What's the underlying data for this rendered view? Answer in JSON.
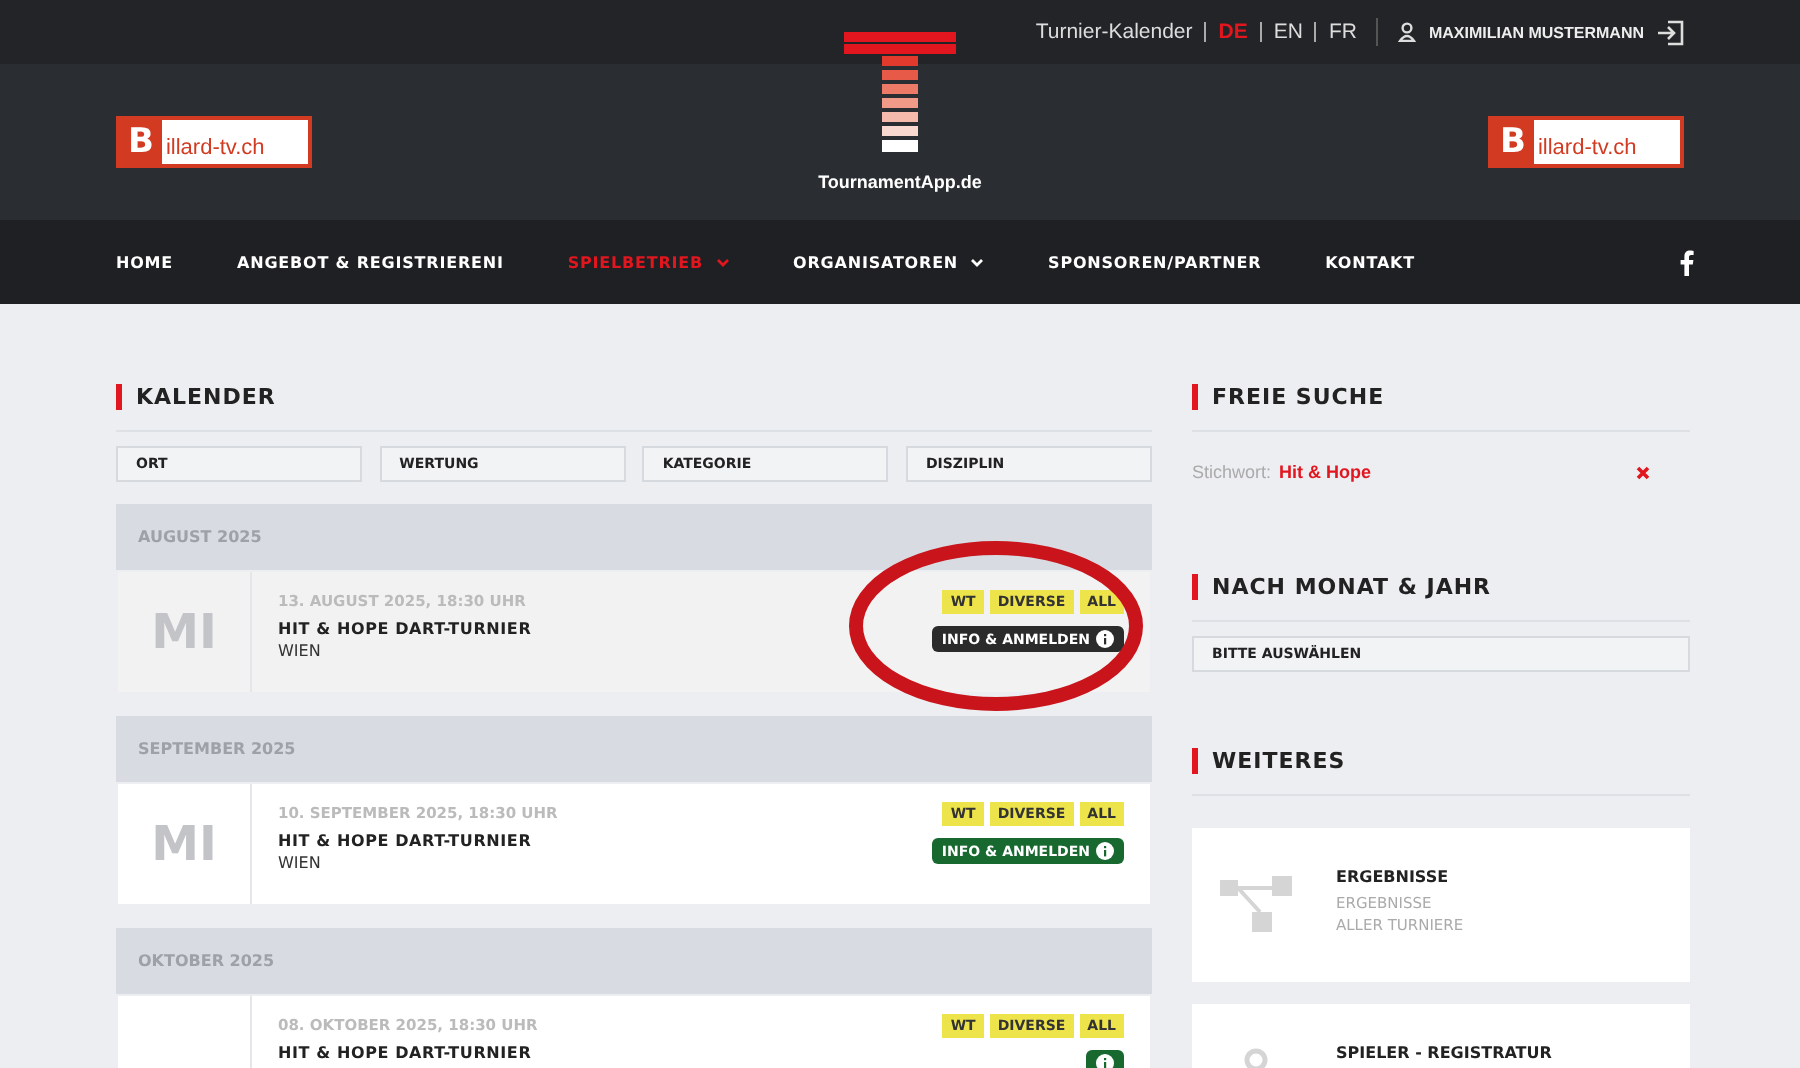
{
  "topbar": {
    "link": "Turnier-Kalender",
    "languages": [
      {
        "label": "DE",
        "selected": true
      },
      {
        "label": "EN",
        "selected": false
      },
      {
        "label": "FR",
        "selected": false
      }
    ],
    "user": "MAXIMILIAN MUSTERMANN"
  },
  "header": {
    "logo_letter": "B",
    "logo_left": "illard-tv.ch",
    "logo_right_letter": "B",
    "logo_center": "TournamentApp.de",
    "logo_right": "illard-tv.ch"
  },
  "nav": [
    {
      "label": "HOME",
      "selected": false,
      "dropdown": false
    },
    {
      "label": "ANGEBOT & REGISTRIERENI",
      "selected": false,
      "dropdown": false
    },
    {
      "label": "SPIELBETRIEB",
      "selected": true,
      "dropdown": true
    },
    {
      "label": "ORGANISATOREN",
      "selected": false,
      "dropdown": true
    },
    {
      "label": "SPONSOREN/PARTNER",
      "selected": false,
      "dropdown": false
    },
    {
      "label": "KONTAKT",
      "selected": false,
      "dropdown": false
    }
  ],
  "calendar": {
    "title": "KALENDER",
    "filters": [
      "ORT",
      "WERTUNG",
      "KATEGORIE",
      "DISZIPLIN"
    ],
    "months": [
      {
        "label": "AUGUST 2025",
        "events": [
          {
            "day": "MI",
            "date": "13. AUGUST 2025, 18:30 UHR",
            "title": "HIT & HOPE DART-TURNIER",
            "place": "WIEN",
            "tags": [
              "WT",
              "DIVERSE",
              "ALL"
            ],
            "button": "INFO & ANMELDEN",
            "past": true
          }
        ]
      },
      {
        "label": "SEPTEMBER 2025",
        "events": [
          {
            "day": "MI",
            "date": "10. SEPTEMBER 2025, 18:30 UHR",
            "title": "HIT & HOPE DART-TURNIER",
            "place": "WIEN",
            "tags": [
              "WT",
              "DIVERSE",
              "ALL"
            ],
            "button": "INFO & ANMELDEN",
            "past": false
          }
        ]
      },
      {
        "label": "OKTOBER 2025",
        "events": [
          {
            "date": "08. OKTOBER 2025, 18:30 UHR",
            "title": "HIT & HOPE DART-TURNIER",
            "tags": [
              "WT",
              "DIVERSE",
              "ALL"
            ],
            "past": false
          }
        ]
      }
    ]
  },
  "sidebar": {
    "search_title": "FREIE SUCHE",
    "keyword_label": "Stichwort:",
    "keyword": "Hit & Hope",
    "month_title": "NACH MONAT & JAHR",
    "month_select": "BITTE AUSWÄHLEN",
    "more_title": "WEITERES",
    "cards": [
      {
        "title": "ERGEBNISSE",
        "lines": [
          "ERGEBNISSE",
          "ALLER TURNIERE"
        ]
      },
      {
        "title": "SPIELER - REGISTRATUR"
      }
    ]
  }
}
